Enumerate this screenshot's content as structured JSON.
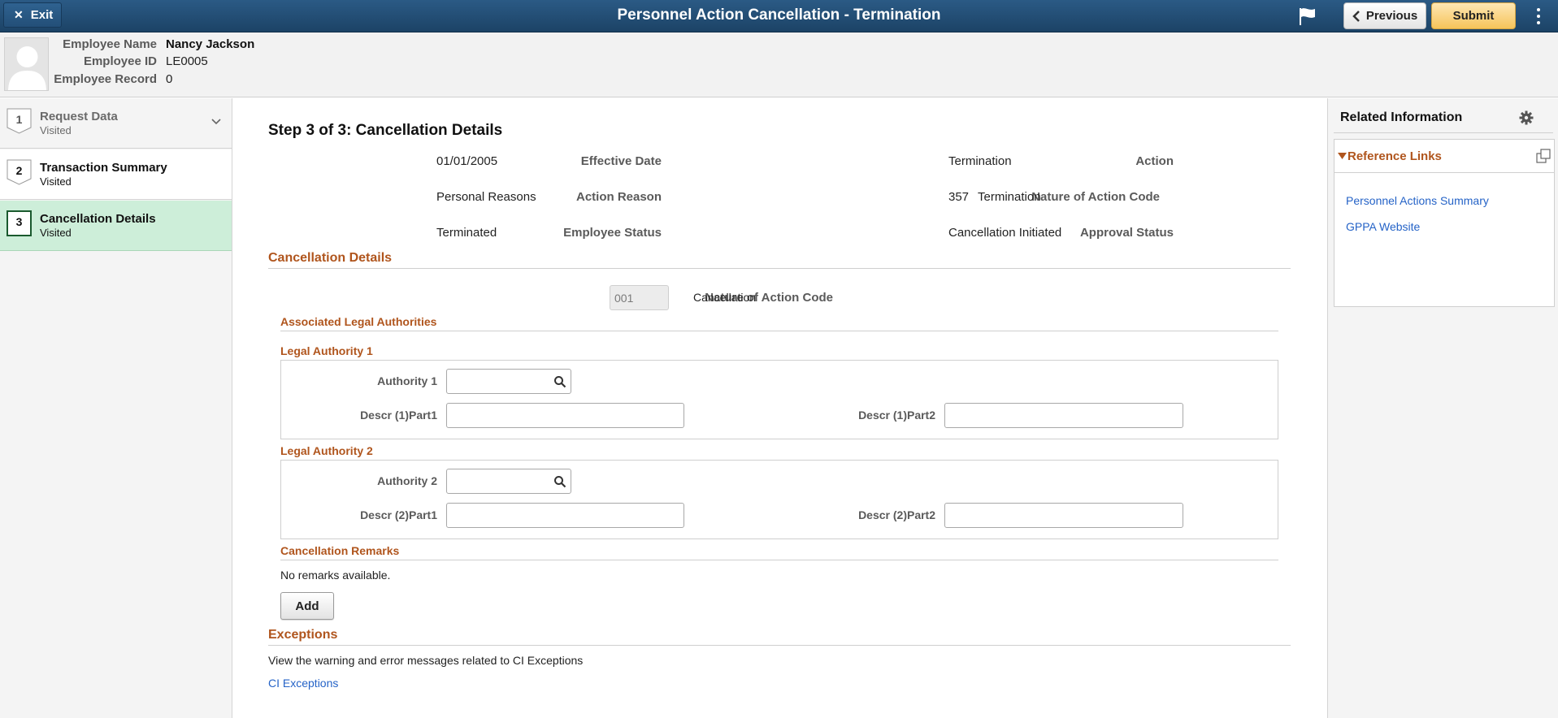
{
  "header": {
    "exit_label": "Exit",
    "title": "Personnel Action Cancellation - Termination",
    "previous_label": "Previous",
    "submit_label": "Submit"
  },
  "employee": {
    "name_label": "Employee Name",
    "name": "Nancy Jackson",
    "id_label": "Employee ID",
    "id": "LE0005",
    "record_label": "Employee Record",
    "record": "0"
  },
  "steps": [
    {
      "num": "1",
      "title": "Request Data",
      "status": "Visited"
    },
    {
      "num": "2",
      "title": "Transaction Summary",
      "status": "Visited"
    },
    {
      "num": "3",
      "title": "Cancellation Details",
      "status": "Visited"
    }
  ],
  "main": {
    "step_title": "Step 3 of 3: Cancellation Details",
    "summary": {
      "effective_date_label": "Effective Date",
      "effective_date": "01/01/2005",
      "action_label": "Action",
      "action": "Termination",
      "action_reason_label": "Action Reason",
      "action_reason": "Personal Reasons",
      "noa_label": "Nature of Action Code",
      "noa_code": "357",
      "noa_descr": "Termination",
      "employee_status_label": "Employee Status",
      "employee_status": "Terminated",
      "approval_status_label": "Approval Status",
      "approval_status": "Cancellation Initiated"
    },
    "cancellation": {
      "section_title": "Cancellation Details",
      "noa_label": "Nature of Action Code",
      "noa_value": "001",
      "noa_descr": "Cancellation",
      "legal_title": "Associated Legal Authorities",
      "la1": {
        "title": "Legal Authority 1",
        "authority_label": "Authority 1",
        "authority_value": "",
        "part1_label": "Descr (1)Part1",
        "part1_value": "",
        "part2_label": "Descr (1)Part2",
        "part2_value": ""
      },
      "la2": {
        "title": "Legal Authority 2",
        "authority_label": "Authority 2",
        "authority_value": "",
        "part1_label": "Descr (2)Part1",
        "part1_value": "",
        "part2_label": "Descr (2)Part2",
        "part2_value": ""
      },
      "remarks_title": "Cancellation Remarks",
      "remarks_text": "No remarks available.",
      "add_label": "Add"
    },
    "exceptions": {
      "title": "Exceptions",
      "description": "View the warning and error messages related to CI Exceptions",
      "link": "CI Exceptions"
    }
  },
  "related": {
    "title": "Related Information",
    "reference_title": "Reference Links",
    "links": [
      "Personnel Actions Summary",
      "GPPA Website"
    ]
  },
  "colors": {
    "header_blue": "#1f4a70",
    "section_orange": "#b0551d",
    "link_blue": "#2563c7",
    "active_step_green": "#cdeed9",
    "submit_gold": "#f6c45a"
  }
}
